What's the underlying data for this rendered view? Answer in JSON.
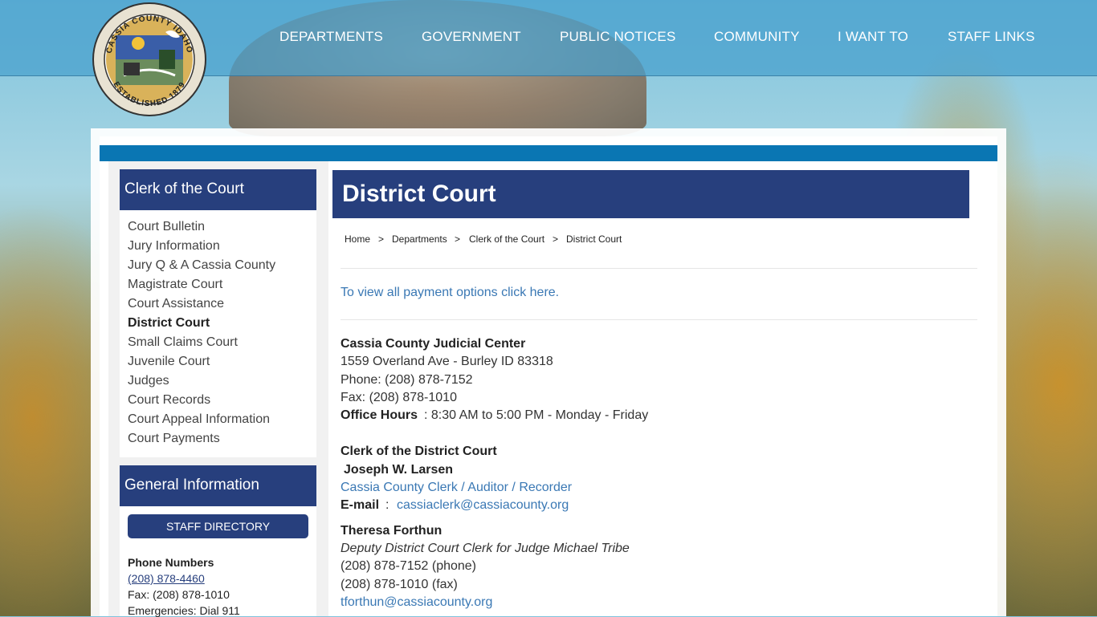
{
  "nav": {
    "items": [
      "DEPARTMENTS",
      "GOVERNMENT",
      "PUBLIC NOTICES",
      "COMMUNITY",
      "I WANT TO",
      "STAFF LINKS"
    ]
  },
  "seal": {
    "top_text": "CASSIA COUNTY IDAHO",
    "bottom_text": "ESTABLISHED 1879"
  },
  "sidebar": {
    "heading": "Clerk of the Court",
    "links": [
      "Court Bulletin",
      "Jury Information",
      "Jury Q & A Cassia County",
      "Magistrate Court",
      "Court Assistance",
      "District Court",
      "Small Claims Court",
      "Juvenile Court",
      "Judges",
      "Court Records",
      "Court Appeal Information",
      "Court Payments"
    ],
    "active_index": 5,
    "general_heading": "General Information",
    "staff_button": "STAFF DIRECTORY",
    "phone_heading": "Phone Numbers",
    "phone_link": "(208) 878-4460",
    "fax": "Fax: (208) 878-1010",
    "emergencies": "Emergencies: Dial 911"
  },
  "main": {
    "title": "District Court",
    "breadcrumb": [
      "Home",
      "Departments",
      "Clerk of the Court",
      "District Court"
    ],
    "breadcrumb_sep": ">",
    "payment_link": "To view all payment options click here.",
    "judicial": {
      "name": "Cassia County Judicial Center",
      "address": "1559 Overland Ave - Burley ID 83318",
      "phone": "Phone: (208) 878-7152",
      "fax": "Fax: (208) 878-1010",
      "hours_label": "Office Hours",
      "hours_value": ": 8:30 AM to 5:00 PM - Monday - Friday"
    },
    "clerk": {
      "heading": "Clerk of the District Court",
      "name": "Joseph W. Larsen",
      "title_link": "Cassia County Clerk / Auditor / Recorder",
      "email_label": "E-mail",
      "email_sep": ":",
      "email": "cassiaclerk@cassiacounty.org"
    },
    "deputy": {
      "name": "Theresa Forthun",
      "title": "Deputy District Court Clerk for Judge Michael Tribe",
      "phone": "(208) 878-7152 (phone)",
      "fax": "(208) 878-1010 (fax)",
      "email": "tforthun@cassiacounty.org"
    }
  },
  "colors": {
    "navy": "#273f7d",
    "stripe": "#0a76b3",
    "link": "#3a78b4"
  }
}
